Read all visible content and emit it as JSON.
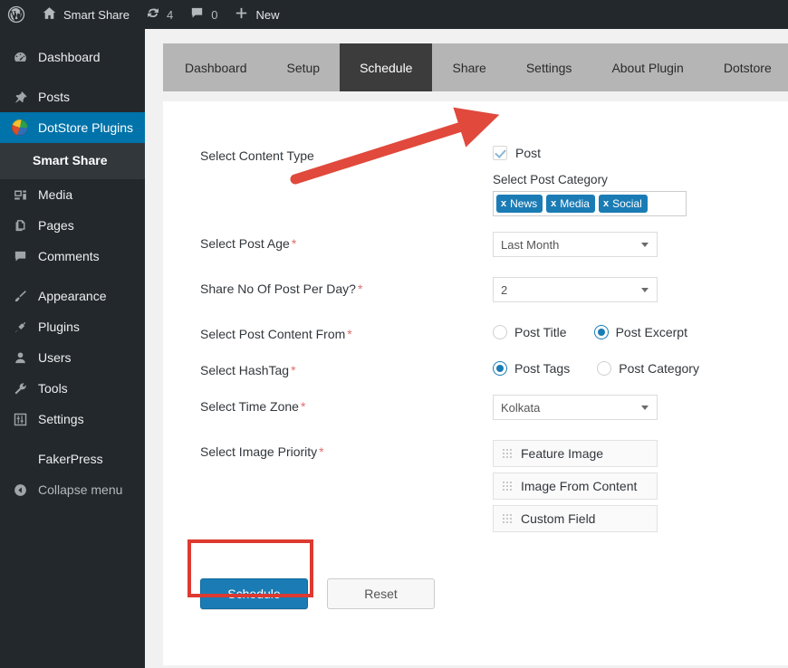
{
  "adminbar": {
    "logo_icon": "wordpress-logo-icon",
    "site_icon": "home-icon",
    "site_name": "Smart Share",
    "updates_icon": "updates-icon",
    "updates_count": "4",
    "comments_icon": "comment-bubble-icon",
    "comments_count": "0",
    "new_icon": "plus-icon",
    "new_label": "New"
  },
  "sidebar": {
    "items": [
      {
        "label": "Dashboard",
        "icon": "dashboard-icon",
        "active": false
      },
      {
        "label": "Posts",
        "icon": "pin-icon",
        "active": false
      },
      {
        "label": "DotStore Plugins",
        "icon": "dotstore-icon",
        "active": true
      },
      {
        "label": "Media",
        "icon": "media-icon",
        "active": false
      },
      {
        "label": "Pages",
        "icon": "pages-icon",
        "active": false
      },
      {
        "label": "Comments",
        "icon": "comment-bubble-icon",
        "active": false
      },
      {
        "label": "Appearance",
        "icon": "paintbrush-icon",
        "active": false
      },
      {
        "label": "Plugins",
        "icon": "plug-icon",
        "active": false
      },
      {
        "label": "Users",
        "icon": "user-icon",
        "active": false
      },
      {
        "label": "Tools",
        "icon": "wrench-icon",
        "active": false
      },
      {
        "label": "Settings",
        "icon": "settings-sliders-icon",
        "active": false
      },
      {
        "label": "FakerPress",
        "icon": "none",
        "active": false
      }
    ],
    "submenu_label": "Smart Share",
    "collapse_label": "Collapse menu",
    "collapse_icon": "collapse-arrow-icon",
    "active_color": "#0073aa"
  },
  "tabs": [
    {
      "label": "Dashboard",
      "active": false
    },
    {
      "label": "Setup",
      "active": false
    },
    {
      "label": "Schedule",
      "active": true
    },
    {
      "label": "Share",
      "active": false
    },
    {
      "label": "Settings",
      "active": false
    },
    {
      "label": "About Plugin",
      "active": false
    },
    {
      "label": "Dotstore",
      "active": false
    }
  ],
  "form": {
    "content_type": {
      "label": "Select Content Type",
      "required": false,
      "checkbox_label": "Post",
      "checkbox_checked": true,
      "category_title": "Select Post Category",
      "categories": [
        "News",
        "Media",
        "Social"
      ],
      "remove_glyph": "x"
    },
    "post_age": {
      "label": "Select Post Age",
      "required": true,
      "value": "Last Month"
    },
    "posts_per_day": {
      "label": "Share No Of Post Per Day?",
      "required": true,
      "value": "2"
    },
    "content_from": {
      "label": "Select Post Content From",
      "required": true,
      "options": [
        {
          "label": "Post Title",
          "selected": false
        },
        {
          "label": "Post Excerpt",
          "selected": true
        }
      ]
    },
    "hashtag": {
      "label": "Select HashTag",
      "required": true,
      "options": [
        {
          "label": "Post Tags",
          "selected": true
        },
        {
          "label": "Post Category",
          "selected": false
        }
      ]
    },
    "time_zone": {
      "label": "Select Time Zone",
      "required": true,
      "value": "Kolkata"
    },
    "image_priority": {
      "label": "Select Image Priority",
      "required": true,
      "items": [
        "Feature Image",
        "Image From Content",
        "Custom Field"
      ],
      "drag_icon": "drag-handle-icon"
    },
    "required_marker": "*",
    "required_color": "#e06c6c"
  },
  "actions": {
    "submit_label": "Schedule",
    "reset_label": "Reset",
    "primary_color": "#1b7cb5"
  },
  "annotations": {
    "arrow_color": "#dd3a30",
    "highlight_box_color": "#dd3a30"
  }
}
